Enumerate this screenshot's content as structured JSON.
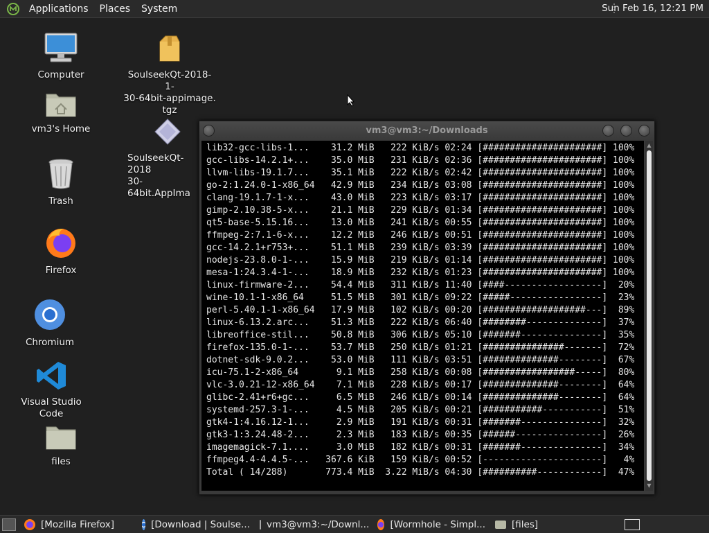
{
  "top_panel": {
    "menus": [
      "Applications",
      "Places",
      "System"
    ],
    "clock": "Sun Feb 16, 12:21 PM"
  },
  "desktop": {
    "computer": "Computer",
    "home": "vm3's Home",
    "trash": "Trash",
    "firefox": "Firefox",
    "chromium": "Chromium",
    "vscode": "Visual Studio Code",
    "files": "files",
    "soulseek_tgz_1": "SoulseekQt-2018-1-",
    "soulseek_tgz_2": "30-64bit-appimage.",
    "soulseek_tgz_3": "tgz",
    "soulseek_app_1": "SoulseekQt-2018",
    "soulseek_app_2": "30-64bit.AppIma"
  },
  "terminal": {
    "title": "vm3@vm3:~/Downloads",
    "lines": [
      "lib32-gcc-libs-1...    31.2 MiB   222 KiB/s 02:24 [######################] 100%",
      "gcc-libs-14.2.1+...    35.0 MiB   231 KiB/s 02:36 [######################] 100%",
      "llvm-libs-19.1.7...    35.1 MiB   222 KiB/s 02:42 [######################] 100%",
      "go-2:1.24.0-1-x86_64   42.9 MiB   234 KiB/s 03:08 [######################] 100%",
      "clang-19.1.7-1-x...    43.0 MiB   223 KiB/s 03:17 [######################] 100%",
      "gimp-2.10.38-5-x...    21.1 MiB   229 KiB/s 01:34 [######################] 100%",
      "qt5-base-5.15.16...    13.0 MiB   241 KiB/s 00:55 [######################] 100%",
      "ffmpeg-2:7.1-6-x...    12.2 MiB   246 KiB/s 00:51 [######################] 100%",
      "gcc-14.2.1+r753+...    51.1 MiB   239 KiB/s 03:39 [######################] 100%",
      "nodejs-23.8.0-1-...    15.9 MiB   219 KiB/s 01:14 [######################] 100%",
      "mesa-1:24.3.4-1-...    18.9 MiB   232 KiB/s 01:23 [######################] 100%",
      "linux-firmware-2...    54.4 MiB   311 KiB/s 11:40 [####------------------]  20%",
      "wine-10.1-1-x86_64     51.5 MiB   301 KiB/s 09:22 [#####-----------------]  23%",
      "perl-5.40.1-1-x86_64   17.9 MiB   102 KiB/s 00:20 [###################---]  89%",
      "linux-6.13.2.arc...    51.3 MiB   222 KiB/s 06:40 [########--------------]  37%",
      "libreoffice-stil...    50.8 MiB   306 KiB/s 05:10 [#######---------------]  35%",
      "firefox-135.0-1-...    53.7 MiB   250 KiB/s 01:21 [###############-------]  72%",
      "dotnet-sdk-9.0.2...    53.0 MiB   111 KiB/s 03:51 [##############--------]  67%",
      "icu-75.1-2-x86_64       9.1 MiB   258 KiB/s 00:08 [#################-----]  80%",
      "vlc-3.0.21-12-x86_64    7.1 MiB   228 KiB/s 00:17 [##############--------]  64%",
      "glibc-2.41+r6+gc...     6.5 MiB   246 KiB/s 00:14 [##############--------]  64%",
      "systemd-257.3-1-...     4.5 MiB   205 KiB/s 00:21 [###########-----------]  51%",
      "gtk4-1:4.16.12-1...     2.9 MiB   191 KiB/s 00:31 [#######---------------]  32%",
      "gtk3-1:3.24.48-2...     2.3 MiB   183 KiB/s 00:35 [######----------------]  26%",
      "imagemagick-7.1....     3.0 MiB   182 KiB/s 00:31 [#######---------------]  34%",
      "ffmpeg4.4-4.4.5-...   367.6 KiB   159 KiB/s 00:52 [----------------------]   4%",
      "Total ( 14/288)       773.4 MiB  3.22 MiB/s 04:30 [##########------------]  47%"
    ]
  },
  "taskbar": {
    "tasks": [
      "[Mozilla Firefox]",
      "[Download | Soulse...",
      "vm3@vm3:~/Downl...",
      "[Wormhole - Simpl...",
      "[files]"
    ]
  }
}
